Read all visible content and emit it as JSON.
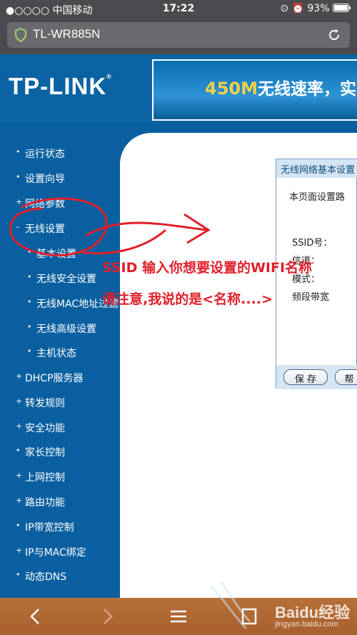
{
  "status_bar": {
    "carrier": "●○○○○ 中国移动",
    "time": "17:22",
    "battery": "93%"
  },
  "address_bar": {
    "url": "TL-WR885N"
  },
  "banner": {
    "logo": "TP-LINK",
    "ad_highlight": "450M",
    "ad_text": "无线速率，实"
  },
  "sidebar": {
    "items": [
      {
        "label": "运行状态",
        "mark": "•"
      },
      {
        "label": "设置向导",
        "mark": "•"
      },
      {
        "label": "网络参数",
        "mark": "+"
      },
      {
        "label": "无线设置",
        "mark": "–"
      },
      {
        "label": "基本设置",
        "mark": "•"
      },
      {
        "label": "无线安全设置",
        "mark": "•"
      },
      {
        "label": "无线MAC地址过滤",
        "mark": "•"
      },
      {
        "label": "无线高级设置",
        "mark": "•"
      },
      {
        "label": "主机状态",
        "mark": "•"
      },
      {
        "label": "DHCP服务器",
        "mark": "+"
      },
      {
        "label": "转发规则",
        "mark": "+"
      },
      {
        "label": "安全功能",
        "mark": "+"
      },
      {
        "label": "家长控制",
        "mark": "•"
      },
      {
        "label": "上网控制",
        "mark": "+"
      },
      {
        "label": "路由功能",
        "mark": "+"
      },
      {
        "label": "IP带宽控制",
        "mark": "•"
      },
      {
        "label": "IP与MAC绑定",
        "mark": "+"
      },
      {
        "label": "动态DNS",
        "mark": "•"
      }
    ]
  },
  "panel": {
    "title": "无线网络基本设置",
    "intro": "本页面设置路",
    "labels": [
      "SSID号：",
      "信道：",
      "模式：",
      "频段带宽"
    ],
    "save_button": "保 存",
    "help_button": "帮"
  },
  "annotations": {
    "line1": "SSID 输入你想要设置的WIFI名称",
    "line2": "请注意,我说的是<名称....>"
  },
  "watermark": {
    "brand": "Baidu经验",
    "site": "jingyan.baidu.com"
  },
  "colors": {
    "sidebar_blue": "#0a5fa0",
    "banner_blue": "#0b63a3",
    "annotation_red": "#e0202a",
    "toolbar_brown": "#ab632f"
  }
}
